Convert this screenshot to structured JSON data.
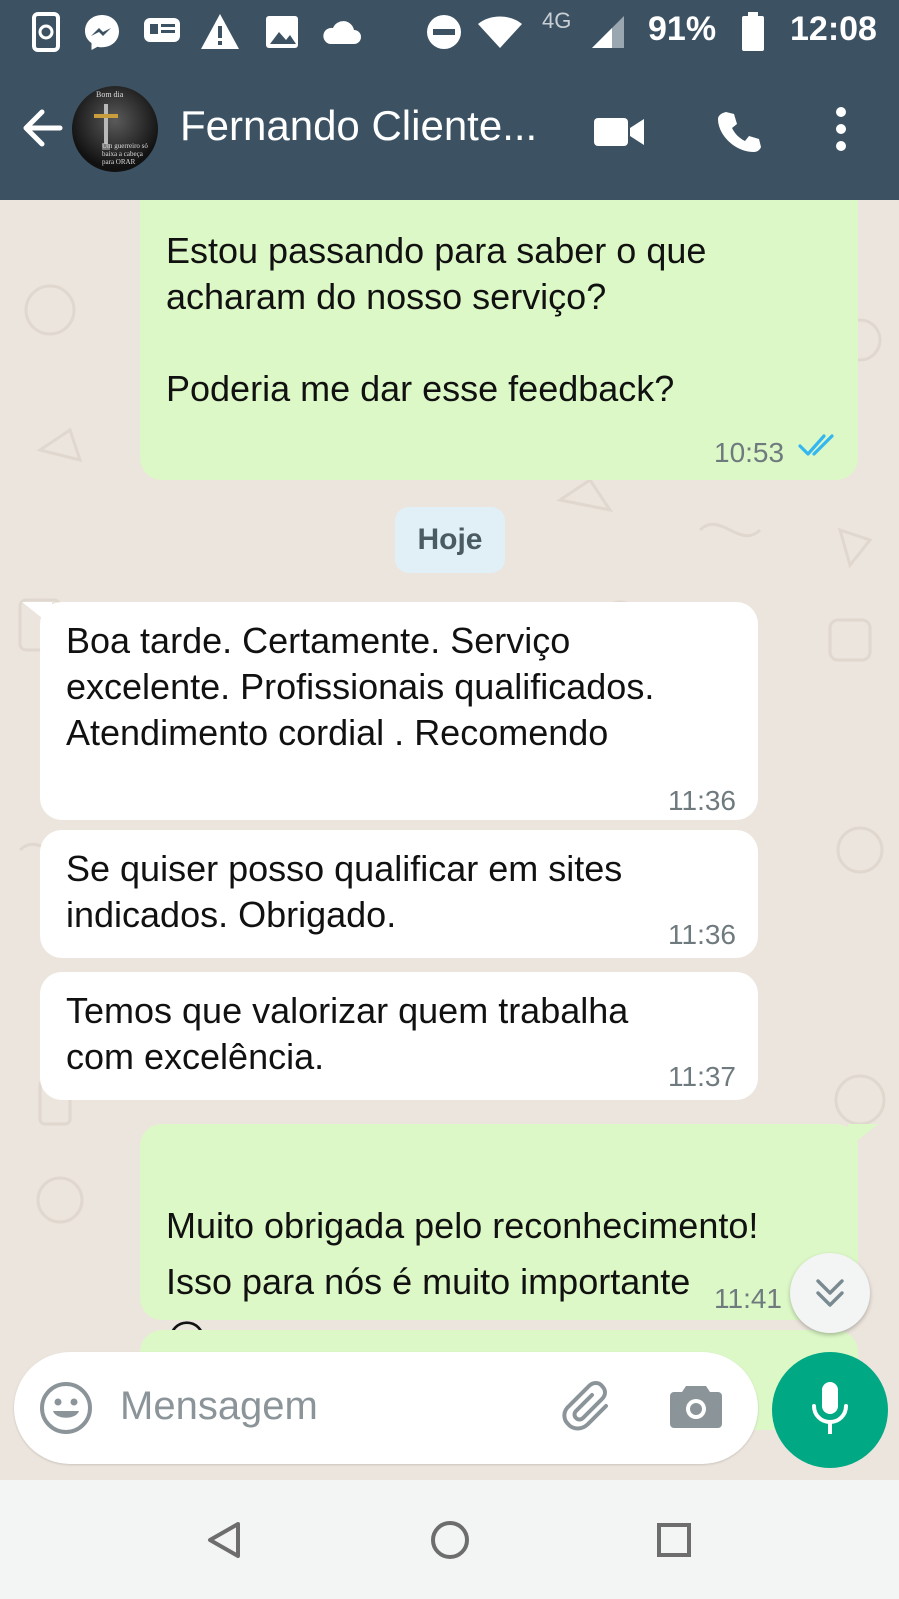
{
  "status_bar": {
    "battery": "91%",
    "network": "4G",
    "time": "12:08",
    "icons": [
      "phone-sync-icon",
      "messenger-icon",
      "message-card-icon",
      "warning-icon",
      "image-icon",
      "cloud-icon",
      "dnd-icon",
      "wifi-icon",
      "signal-icon",
      "battery-icon"
    ]
  },
  "header": {
    "contact_name": "Fernando Cliente...",
    "avatar_text": {
      "top": "Bom dia",
      "bottom": "Um guerreiro só baixa a cabeça para ORAR"
    }
  },
  "chat": {
    "messages": [
      {
        "direction": "out",
        "text": "Estou passando para saber o que\nacharam do nosso serviço?\n\nPoderia me dar esse feedback?",
        "time": "10:53",
        "status": "read"
      },
      {
        "direction": "in",
        "text": "Boa tarde. Certamente.  Serviço\nexcelente. Profissionais qualificados.\nAtendimento cordial . Recomendo",
        "time": "11:36"
      },
      {
        "direction": "in",
        "text": "Se quiser posso qualificar em sites\nindicados.  Obrigado.",
        "time": "11:36"
      },
      {
        "direction": "in",
        "text": "Temos que valorizar quem trabalha\ncom excelência.",
        "time": "11:37"
      },
      {
        "direction": "out",
        "text": "Muito obrigada pelo reconhecimento!\nIsso para nós é muito importante",
        "emoji": "😀",
        "time": "11:41",
        "status": "read"
      }
    ],
    "day_label": "Hoje"
  },
  "input": {
    "placeholder": "Mensagem"
  },
  "colors": {
    "header": "#3c5263",
    "outgoing": "#dcf8c6",
    "incoming": "#ffffff",
    "accent": "#00a884",
    "read_ticks": "#34b7f1"
  }
}
